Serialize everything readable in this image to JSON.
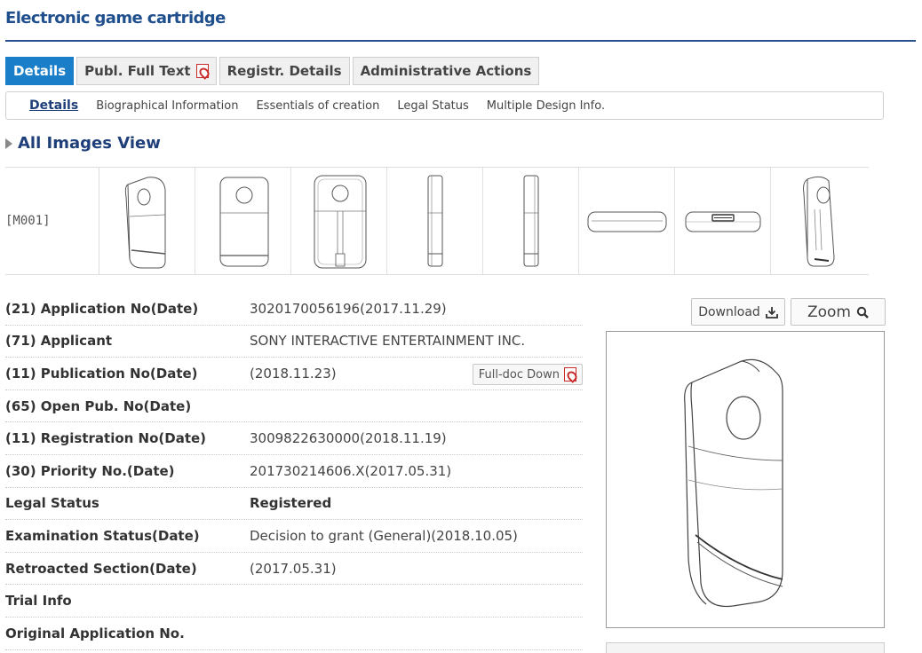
{
  "page": {
    "title": "Electronic game cartridge"
  },
  "tabs": [
    {
      "label": "Details",
      "active": true
    },
    {
      "label": "Publ. Full Text",
      "icon": "pdf-icon"
    },
    {
      "label": "Registr. Details"
    },
    {
      "label": "Administrative Actions"
    }
  ],
  "subtabs": [
    {
      "label": "Details",
      "active": true
    },
    {
      "label": "Biographical Information"
    },
    {
      "label": "Essentials of creation"
    },
    {
      "label": "Legal Status"
    },
    {
      "label": "Multiple Design Info."
    }
  ],
  "images": {
    "section_title": "All Images View",
    "model_code": "[M001]",
    "thumbnails": [
      "perspective-view",
      "front-view",
      "rear-view",
      "left-side-view",
      "right-side-view",
      "top-view",
      "bottom-view",
      "rear-perspective-view"
    ]
  },
  "fields": [
    {
      "label": "(21) Application No(Date)",
      "value": "3020170056196(2017.11.29)"
    },
    {
      "label": "(71) Applicant",
      "value": "SONY INTERACTIVE ENTERTAINMENT INC."
    },
    {
      "label": "(11) Publication No(Date)",
      "value": "(2018.11.23)",
      "button": "Full-doc Down"
    },
    {
      "label": "(65) Open Pub. No(Date)",
      "value": ""
    },
    {
      "label": "(11) Registration No(Date)",
      "value": "3009822630000(2018.11.19)"
    },
    {
      "label": "(30) Priority No.(Date)",
      "value": "201730214606.X(2017.05.31)"
    },
    {
      "label": "Legal Status",
      "value": "Registered",
      "bold": true
    },
    {
      "label": "Examination Status(Date)",
      "value": "Decision to grant (General)(2018.10.05)"
    },
    {
      "label": "Retroacted Section(Date)",
      "value": "(2017.05.31)"
    },
    {
      "label": "Trial Info",
      "value": ""
    },
    {
      "label": "Original Application No.",
      "value": ""
    }
  ],
  "actions": {
    "download_label": "Download",
    "zoom_label": "Zoom"
  },
  "colors": {
    "accent": "#1a7ec8",
    "title": "#1f4f8c",
    "pdf": "#c92a2a"
  }
}
